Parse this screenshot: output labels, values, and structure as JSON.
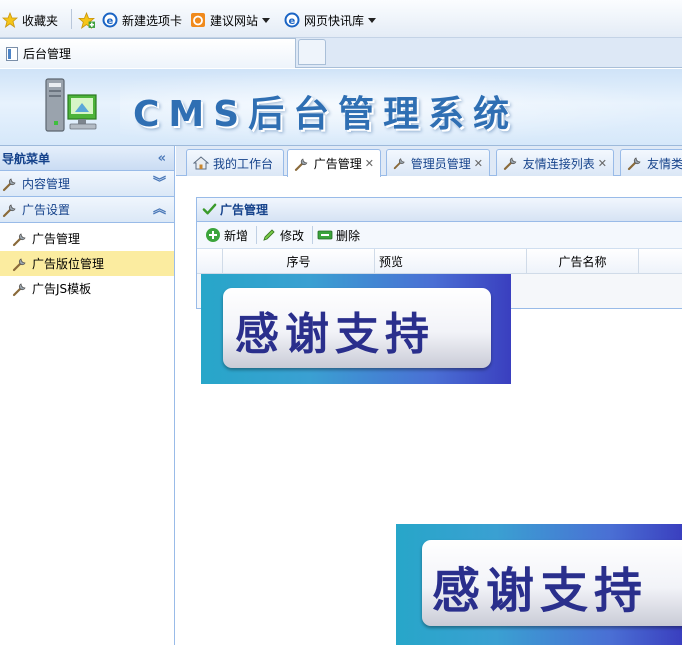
{
  "browser": {
    "favorites": [
      {
        "label": "收藏夹",
        "icon": "star-icon"
      },
      {
        "label": "新建选项卡",
        "icon": "ie-icon"
      },
      {
        "label": "建议网站",
        "icon": "suggested-sites-icon"
      },
      {
        "label": "网页快讯库",
        "icon": "web-slice-icon"
      }
    ],
    "tab_title": "后台管理"
  },
  "header": {
    "title": "CMS后台管理系统"
  },
  "nav": {
    "title": "导航菜单",
    "sections": [
      {
        "label": "内容管理",
        "expanded": false
      },
      {
        "label": "广告设置",
        "expanded": true,
        "items": [
          "广告管理",
          "广告版位管理",
          "广告JS模板"
        ],
        "selected": 1
      }
    ]
  },
  "tabs": [
    {
      "label": "我的工作台",
      "closable": false
    },
    {
      "label": "广告管理",
      "closable": true,
      "active": true
    },
    {
      "label": "管理员管理",
      "closable": true
    },
    {
      "label": "友情连接列表",
      "closable": true
    },
    {
      "label": "友情类",
      "closable": false
    }
  ],
  "panel": {
    "title": "广告管理",
    "toolbar": [
      "新增",
      "修改",
      "删除"
    ],
    "columns": [
      "序号",
      "预览",
      "广告名称"
    ]
  },
  "overlay": {
    "text": "感谢支持"
  },
  "colors": {
    "accent": "#15428b",
    "selected": "#fbeca0",
    "header_title": "#2f6fb3"
  }
}
